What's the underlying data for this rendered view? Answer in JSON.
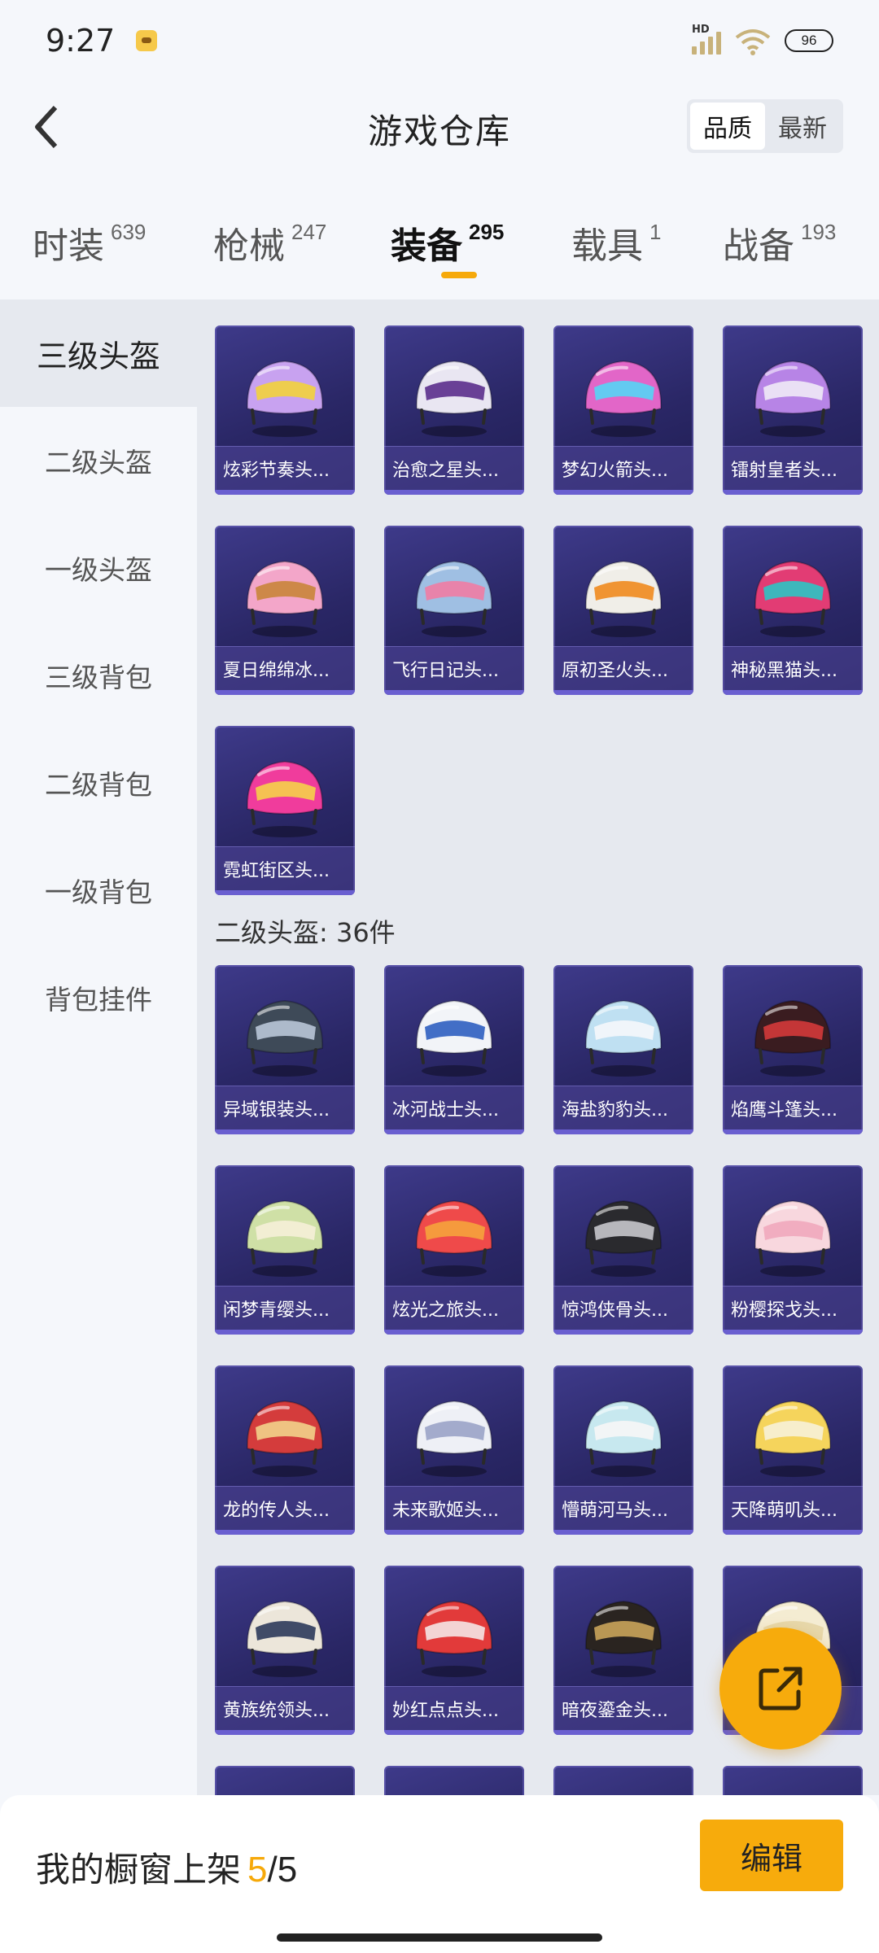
{
  "status": {
    "time": "9:27",
    "battery": "96",
    "network": "HD"
  },
  "header": {
    "title": "游戏仓库",
    "sort_options": [
      "品质",
      "最新"
    ],
    "active_sort": 0
  },
  "tabs": [
    {
      "label": "时装",
      "count": "639"
    },
    {
      "label": "枪械",
      "count": "247"
    },
    {
      "label": "装备",
      "count": "295",
      "active": true
    },
    {
      "label": "载具",
      "count": "1"
    },
    {
      "label": "战备",
      "count": "193"
    }
  ],
  "sidebar": {
    "items": [
      "三级头盔",
      "二级头盔",
      "一级头盔",
      "三级背包",
      "二级背包",
      "一级背包",
      "背包挂件"
    ],
    "active_index": 0
  },
  "level3": {
    "items": [
      {
        "name": "炫彩节奏头...",
        "colors": [
          "#c8a2f0",
          "#f2d23c"
        ]
      },
      {
        "name": "治愈之星头...",
        "colors": [
          "#e9e6f2",
          "#5b2d8c"
        ]
      },
      {
        "name": "梦幻火箭头...",
        "colors": [
          "#e266c8",
          "#55d5f5"
        ]
      },
      {
        "name": "镭射皇者头...",
        "colors": [
          "#b784e6",
          "#f0eaf6"
        ]
      },
      {
        "name": "夏日绵绵冰...",
        "colors": [
          "#f3a6c9",
          "#c9853a"
        ]
      },
      {
        "name": "飞行日记头...",
        "colors": [
          "#9fbfe3",
          "#f07ca3"
        ]
      },
      {
        "name": "原初圣火头...",
        "colors": [
          "#f0eee8",
          "#f08a1e"
        ]
      },
      {
        "name": "神秘黑猫头...",
        "colors": [
          "#e23c74",
          "#2cc4c4"
        ]
      },
      {
        "name": "霓虹街区头...",
        "colors": [
          "#f03c9c",
          "#f5d04a"
        ]
      }
    ]
  },
  "level2": {
    "title": "二级头盔: 36件",
    "items": [
      {
        "name": "异域银装头...",
        "colors": [
          "#3e4a58",
          "#b9c7d8"
        ]
      },
      {
        "name": "冰河战士头...",
        "colors": [
          "#f2f4f8",
          "#2f5fc0"
        ]
      },
      {
        "name": "海盐豹豹头...",
        "colors": [
          "#bfe0f2",
          "#f5f7fb"
        ]
      },
      {
        "name": "焰鹰斗篷头...",
        "colors": [
          "#3a1c20",
          "#d43a3a"
        ]
      },
      {
        "name": "闲梦青缨头...",
        "colors": [
          "#cfe0a6",
          "#f5f0d8"
        ]
      },
      {
        "name": "炫光之旅头...",
        "colors": [
          "#ef4a4a",
          "#f5a33c"
        ]
      },
      {
        "name": "惊鸿侠骨头...",
        "colors": [
          "#2a2a2e",
          "#c7c7cc"
        ]
      },
      {
        "name": "粉樱探戈头...",
        "colors": [
          "#f8d7de",
          "#f0a8bd"
        ]
      },
      {
        "name": "龙的传人头...",
        "colors": [
          "#d43c3c",
          "#f2d28a"
        ]
      },
      {
        "name": "未来歌姬头...",
        "colors": [
          "#eef0f6",
          "#9aa3c8"
        ]
      },
      {
        "name": "懵萌河马头...",
        "colors": [
          "#c7e8ef",
          "#f6f6f6"
        ]
      },
      {
        "name": "天降萌叽头...",
        "colors": [
          "#f5d45c",
          "#f7f1d8"
        ]
      },
      {
        "name": "黄族统领头...",
        "colors": [
          "#ece6da",
          "#2e3a5a"
        ]
      },
      {
        "name": "妙红点点头...",
        "colors": [
          "#e23a3a",
          "#f5e6e6"
        ]
      },
      {
        "name": "暗夜鎏金头...",
        "colors": [
          "#2a2420",
          "#c9a45a"
        ]
      },
      {
        "name": "",
        "colors": [
          "#f4ecd2",
          "#e6d6a6"
        ]
      },
      {
        "name": "",
        "colors": [
          "#f5f5f5",
          "#333"
        ]
      },
      {
        "name": "",
        "colors": [
          "#f5f5f5",
          "#333"
        ]
      },
      {
        "name": "",
        "colors": [
          "#f5f5f5",
          "#333"
        ]
      },
      {
        "name": "",
        "colors": [
          "#f5f5f5",
          "#333"
        ]
      }
    ]
  },
  "bottom": {
    "label": "我的橱窗上架",
    "current": "5",
    "total": "/5",
    "edit_label": "编辑"
  },
  "colors": {
    "accent": "#f7ab0c",
    "card_bg": "#2a2766"
  }
}
